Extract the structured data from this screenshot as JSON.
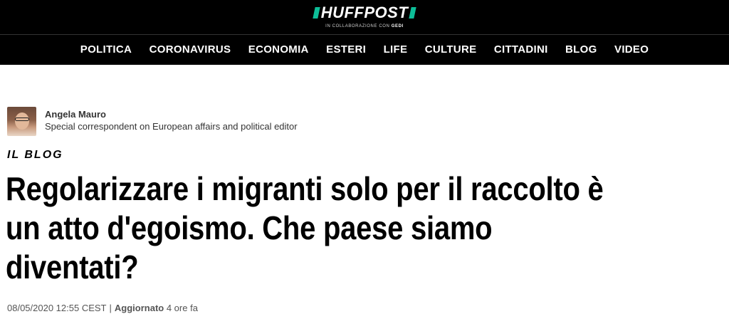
{
  "header": {
    "logo_text": "HUFFPOST",
    "logo_subtitle": "IN COLLABORAZIONE CON",
    "logo_partner": "GEDI",
    "accent_color": "#0dbe98",
    "background_color": "#000000"
  },
  "nav": {
    "items": [
      {
        "label": "POLITICA"
      },
      {
        "label": "CORONAVIRUS"
      },
      {
        "label": "ECONOMIA"
      },
      {
        "label": "ESTERI"
      },
      {
        "label": "LIFE"
      },
      {
        "label": "CULTURE"
      },
      {
        "label": "CITTADINI"
      },
      {
        "label": "BLOG"
      },
      {
        "label": "VIDEO"
      }
    ]
  },
  "author": {
    "name": "Angela Mauro",
    "role": "Special correspondent on European affairs and political editor"
  },
  "article": {
    "section": "IL BLOG",
    "headline_lines": [
      "Regolarizzare i migranti solo per il raccolto è",
      "un atto d'egoismo. Che paese siamo",
      "diventati?"
    ],
    "published": "08/05/2020 12:55 CEST",
    "separator": "|",
    "updated_label": "Aggiornato",
    "updated_value": "4 ore fa"
  }
}
